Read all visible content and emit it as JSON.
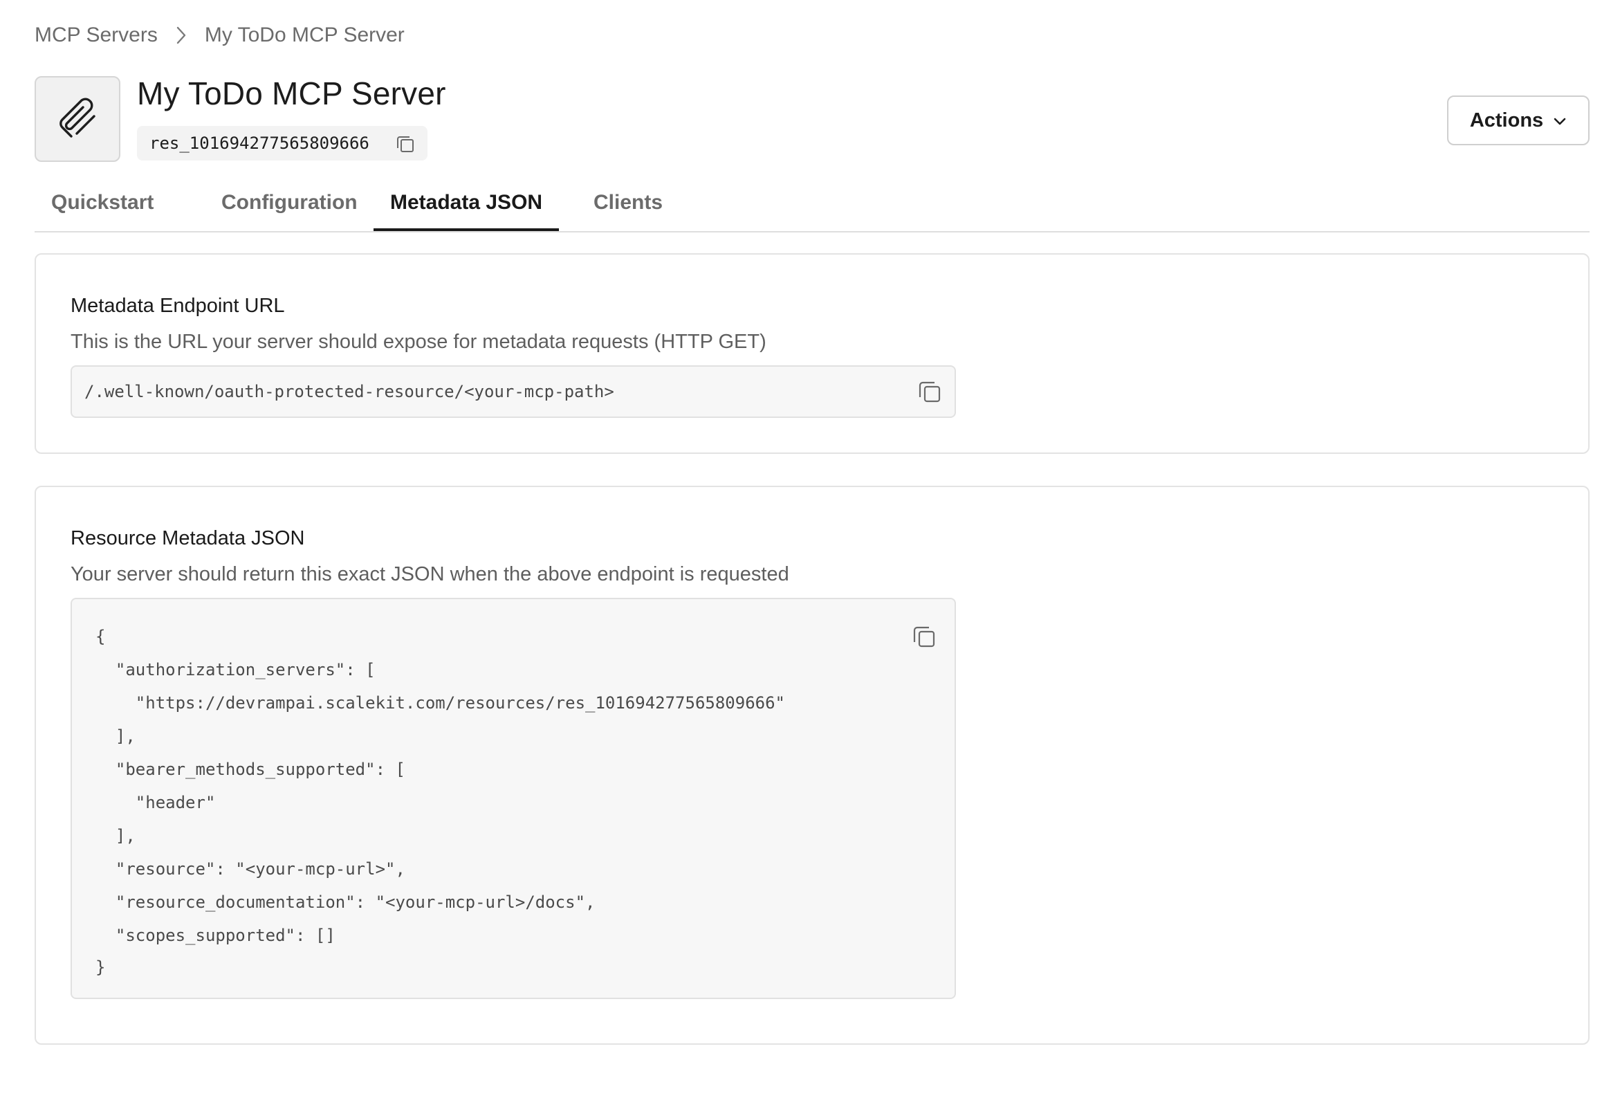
{
  "breadcrumb": {
    "parent": "MCP Servers",
    "current": "My ToDo MCP Server"
  },
  "header": {
    "title": "My ToDo MCP Server",
    "resource_id": "res_101694277565809666",
    "actions_label": "Actions"
  },
  "tabs": [
    {
      "label": "Quickstart"
    },
    {
      "label": "Configuration"
    },
    {
      "label": "Metadata JSON"
    },
    {
      "label": "Clients"
    }
  ],
  "active_tab": "Metadata JSON",
  "endpoint_card": {
    "title": "Metadata Endpoint URL",
    "description": "This is the URL your server should expose for metadata requests (HTTP GET)",
    "url": "/.well-known/oauth-protected-resource/<your-mcp-path>"
  },
  "json_card": {
    "title": "Resource Metadata JSON",
    "description": "Your server should return this exact JSON when the above endpoint is requested",
    "code_lines": [
      "{",
      "  \"authorization_servers\": [",
      "    \"https://devrampai.scalekit.com/resources/res_101694277565809666\"",
      "  ],",
      "  \"bearer_methods_supported\": [",
      "    \"header\"",
      "  ],",
      "  \"resource\": \"<your-mcp-url>\",",
      "  \"resource_documentation\": \"<your-mcp-url>/docs\",",
      "  \"scopes_supported\": []",
      "}"
    ]
  },
  "icons": {
    "breadcrumb_separator": "chevron-right-icon",
    "server": "paperclip-icon",
    "copy": "copy-icon",
    "actions": "chevron-down-icon"
  },
  "colors": {
    "accent": "#1a1a1a",
    "muted_text": "#6b6b6b",
    "code_bg": "#f7f7f7",
    "border": "#e3e3e3"
  }
}
